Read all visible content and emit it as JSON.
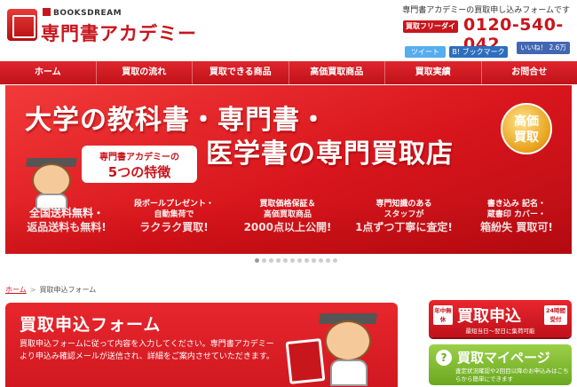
{
  "header": {
    "brand_small": "BOOKSDREAM",
    "brand_main": "専門書アカデミー",
    "tagline": "専門書アカデミーの買取申し込みフォームです",
    "phone_label": "買取フリーダイヤル",
    "phone_number": "0120-540-042",
    "tweet_label": "ツイート",
    "hatena_label": "B! ブックマーク 20",
    "like_label": "いいね！ 2.6万"
  },
  "nav": {
    "items": [
      {
        "label": "ホーム"
      },
      {
        "label": "買取の流れ"
      },
      {
        "label": "買取できる商品"
      },
      {
        "label": "高価買取商品"
      },
      {
        "label": "買取実績"
      },
      {
        "label": "お問合せ"
      }
    ]
  },
  "hero": {
    "line1": "大学の教科書・専門書・",
    "line2": "医学書の専門買取店",
    "badge_l1": "高価",
    "badge_l2": "買取",
    "feature_label_l1": "専門書アカデミーの",
    "feature_label_l2": "5つの特徴",
    "features": [
      {
        "small": "",
        "big1": "全国送料無料・",
        "big2": "返品送料も無料!"
      },
      {
        "small": "段ボールプレゼント・",
        "small2": "自動集荷で",
        "big1": "ラクラク買取!"
      },
      {
        "small": "買取価格保証＆",
        "small2": "高価買取商品",
        "big1": "2000点以上公開!"
      },
      {
        "small": "専門知識のある",
        "small2": "スタッフが",
        "big1": "1点ずつ丁寧に査定!"
      },
      {
        "small": "書き込み 記名・",
        "small2": "蔵書印 カバー・",
        "big1": "箱紛失 買取可!"
      }
    ]
  },
  "carousel": {
    "count": 12,
    "active_index": 0
  },
  "breadcrumb": {
    "home": "ホーム",
    "current": "買取申込フォーム"
  },
  "form_panel": {
    "title": "買取申込フォーム",
    "desc": "買取申込フォームに従って内容を入力してください。専門書アカデミーより申込み確認メールが送信され、詳細をご案内させていただきます。"
  },
  "apply": {
    "tag_left": "年中無休",
    "title": "買取申込",
    "tag_right": "24時間受付",
    "sub": "最短当日〜翌日に集荷可能"
  },
  "mypage": {
    "title": "買取マイページ",
    "sub": "査定状況確認や2回目以降のお申込みはこちらから簡単にできます"
  }
}
